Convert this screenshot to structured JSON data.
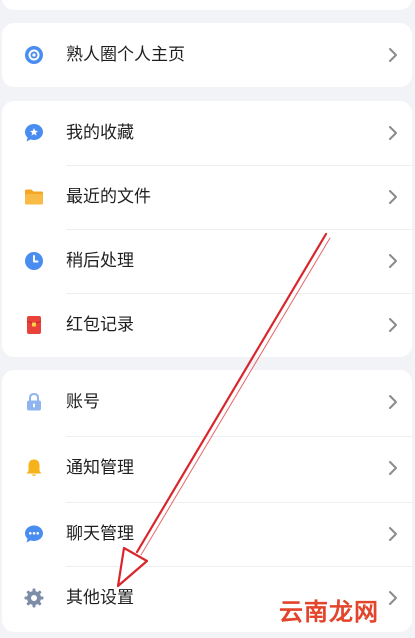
{
  "menu": {
    "group1": [
      {
        "label": "熟人圈个人主页",
        "icon": "circle-profile-icon"
      }
    ],
    "group2": [
      {
        "label": "我的收藏",
        "icon": "star-bubble-icon"
      },
      {
        "label": "最近的文件",
        "icon": "folder-icon"
      },
      {
        "label": "稍后处理",
        "icon": "clock-icon"
      },
      {
        "label": "红包记录",
        "icon": "red-envelope-icon"
      }
    ],
    "group3": [
      {
        "label": "账号",
        "icon": "lock-icon"
      },
      {
        "label": "通知管理",
        "icon": "bell-icon"
      },
      {
        "label": "聊天管理",
        "icon": "chat-bubble-icon"
      },
      {
        "label": "其他设置",
        "icon": "gear-icon"
      }
    ]
  },
  "watermark": "云南龙网",
  "colors": {
    "background": "#f2f3f7",
    "card": "#ffffff",
    "icon_blue": "#4a8df0",
    "folder_orange": "#f5a623",
    "envelope_red": "#e8423a",
    "bell_yellow": "#f5b21a",
    "lock_blue": "#8fb4ef",
    "arrow_red": "#d9262c"
  }
}
